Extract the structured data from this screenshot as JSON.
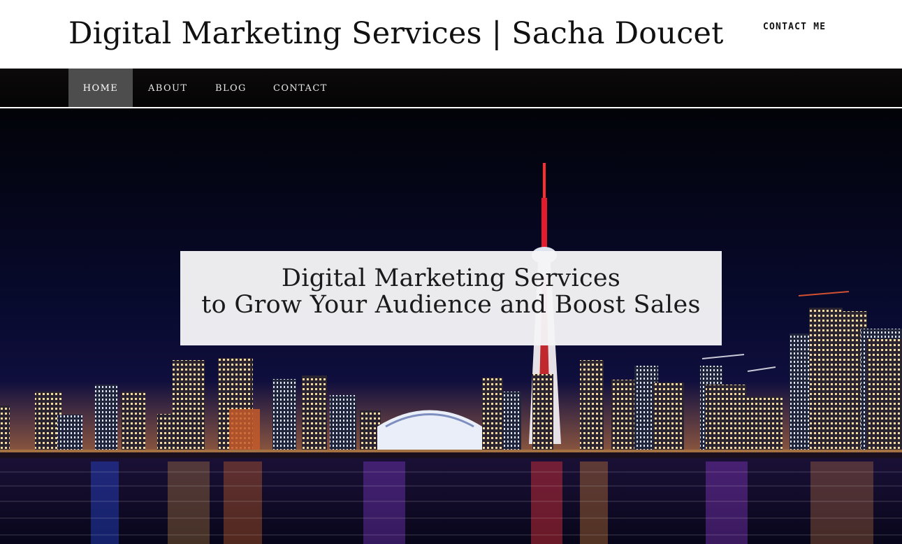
{
  "header": {
    "site_title": "Digital Marketing Services | Sacha Doucet",
    "contact_label": "CONTACT ME"
  },
  "nav": {
    "items": [
      {
        "label": "HOME",
        "active": true
      },
      {
        "label": "ABOUT",
        "active": false
      },
      {
        "label": "BLOG",
        "active": false
      },
      {
        "label": "CONTACT",
        "active": false
      }
    ]
  },
  "hero": {
    "line1": "Digital Marketing Services",
    "line2": "to Grow Your Audience and Boost Sales",
    "image": "city-skyline-night-photo"
  },
  "colors": {
    "nav_bg": "#0a0808",
    "nav_active_bg": "#4d4d4d",
    "hero_sky": "#05061a",
    "hero_box_bg": "#f5f5f7"
  }
}
